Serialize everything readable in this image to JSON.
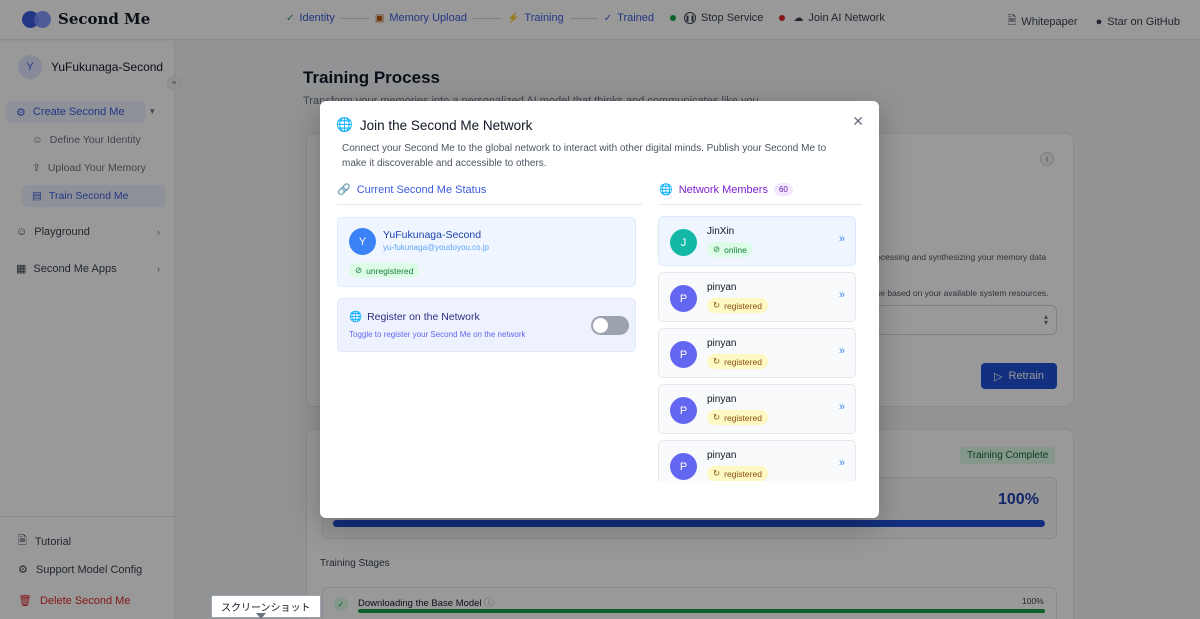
{
  "app": {
    "title": "Second Me"
  },
  "steps": [
    {
      "label": "Identity",
      "icon": "pen-icon"
    },
    {
      "label": "Memory Upload",
      "icon": "box-icon"
    },
    {
      "label": "Training",
      "icon": "bolt-icon"
    },
    {
      "label": "Trained",
      "icon": "check-icon"
    },
    {
      "label": "Stop Service"
    },
    {
      "label": "Join AI Network"
    }
  ],
  "top_links": {
    "whitepaper": "Whitepaper",
    "github": "Star on GitHub"
  },
  "sidebar": {
    "user_initial": "Y",
    "user_name": "YuFukunaga-Second",
    "main_item": "Create Second Me",
    "sub_items": [
      "Define Your Identity",
      "Upload Your Memory",
      "Train Second Me"
    ],
    "playground": "Playground",
    "apps": "Second Me Apps",
    "tutorial": "Tutorial",
    "support": "Support Model Config",
    "delete": "Delete Second Me"
  },
  "main": {
    "title": "Training Process",
    "subtitle": "Transform your memories into a personalized AI model that thinks and communicates like you.",
    "hint1": "ocessing and synthesizing your memory data",
    "hint2": "se based on your available system resources.",
    "retrain": "Retrain",
    "status_badge": "Training Complete",
    "progress_pct": "100%",
    "progress_value": 100,
    "stages_title": "Training Stages",
    "stage1_label": "Downloading the Base Model",
    "stage1_pct": "100%"
  },
  "modal": {
    "title": "Join the Second Me Network",
    "description": "Connect your Second Me to the global network to interact with other digital minds. Publish your Second Me to make it discoverable and accessible to others.",
    "status_header": "Current Second Me Status",
    "members_header": "Network Members",
    "members_count": "60",
    "me": {
      "initial": "Y",
      "name": "YuFukunaga-Second",
      "email": "yu-fukunaga@youdoyou.co.jp",
      "status": "unregistered"
    },
    "register_title": "Register on the Network",
    "register_sub": "Toggle to register your Second Me on the network",
    "members": [
      {
        "initial": "J",
        "name": "JinXin",
        "status": "online",
        "color": "#14b8a6"
      },
      {
        "initial": "P",
        "name": "pinyan",
        "status": "registered",
        "color": "#6366f1"
      },
      {
        "initial": "P",
        "name": "pinyan",
        "status": "registered",
        "color": "#6366f1"
      },
      {
        "initial": "P",
        "name": "pinyan",
        "status": "registered",
        "color": "#6366f1"
      },
      {
        "initial": "P",
        "name": "pinyan",
        "status": "registered",
        "color": "#6366f1"
      }
    ]
  },
  "tooltip": "スクリーンショット"
}
